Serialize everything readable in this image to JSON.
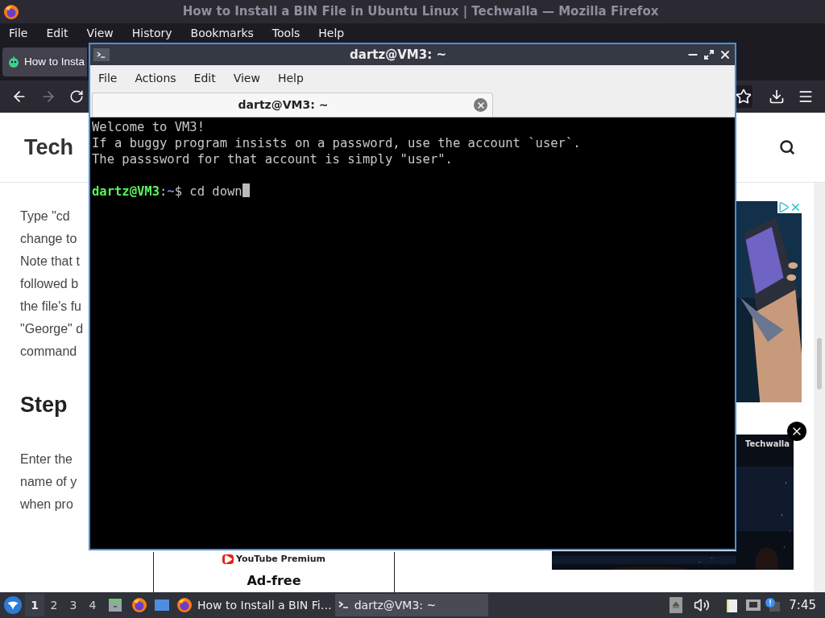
{
  "browser": {
    "title": "How to Install a BIN File in Ubuntu Linux | Techwalla — Mozilla Firefox",
    "menu": [
      "File",
      "Edit",
      "View",
      "History",
      "Bookmarks",
      "Tools",
      "Help"
    ],
    "tab": {
      "label": "How to Insta"
    },
    "page": {
      "logo": "Tech",
      "blocks": [
        {
          "kind": "text",
          "lines": [
            "Type \"cd",
            "change to",
            "Note that t",
            "followed b",
            "the file's fu",
            "\"George\" d",
            "command"
          ]
        },
        {
          "kind": "heading",
          "text": "Step"
        },
        {
          "kind": "text",
          "lines": [
            "Enter the",
            "name of y",
            "when pro"
          ]
        }
      ],
      "ad_brand": "Techwalla",
      "promo_logo": "YouTube Premium",
      "promo_text": "Ad-free"
    }
  },
  "terminal": {
    "title": "dartz@VM3: ~",
    "menu": [
      "File",
      "Actions",
      "Edit",
      "View",
      "Help"
    ],
    "tab": {
      "label": "dartz@VM3: ~"
    },
    "lines": [
      {
        "kind": "output",
        "text": "Welcome to VM3!"
      },
      {
        "kind": "output",
        "text": "If a buggy program insists on a password, use the account `user`."
      },
      {
        "kind": "output",
        "text": "The passsword for that account is simply \"user\"."
      },
      {
        "kind": "blank"
      },
      {
        "kind": "prompt",
        "user": "dartz@VM3",
        "separator": ":",
        "path": "~",
        "symbol": "$",
        "command": "cd down"
      }
    ]
  },
  "taskbar": {
    "workspaces": [
      {
        "label": "1",
        "selected": true
      },
      {
        "label": "2",
        "selected": false
      },
      {
        "label": "3",
        "selected": false
      },
      {
        "label": "4",
        "selected": false
      }
    ],
    "tasks": [
      {
        "kind": "firefox",
        "label": "How to Install a BIN Fi…",
        "selected": false
      },
      {
        "kind": "terminal",
        "label": "dartz@VM3: ~",
        "selected": true
      }
    ],
    "clock": "7:45"
  }
}
